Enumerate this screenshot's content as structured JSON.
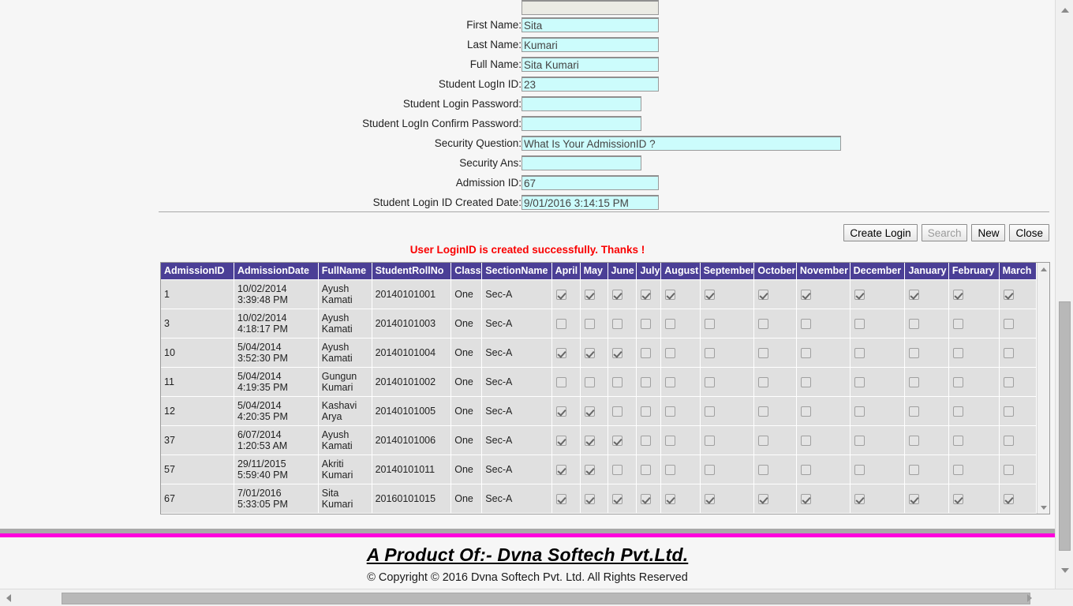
{
  "form": {
    "fields": [
      {
        "label": "First Name:",
        "value": "Sita",
        "placeholder": "",
        "width": "w-std",
        "type": "text"
      },
      {
        "label": "Last Name:",
        "value": "Kumari",
        "placeholder": "",
        "width": "w-std",
        "type": "text"
      },
      {
        "label": "Full Name:",
        "value": "Sita Kumari",
        "placeholder": "",
        "width": "w-std",
        "type": "text"
      },
      {
        "label": "Student LogIn ID:",
        "value": "23",
        "placeholder": "",
        "width": "w-std",
        "type": "text"
      },
      {
        "label": "Student Login Password:",
        "value": "",
        "placeholder": "",
        "width": "w-pw",
        "type": "password"
      },
      {
        "label": "Student LogIn Confirm Password:",
        "value": "",
        "placeholder": "",
        "width": "w-pw",
        "type": "password"
      },
      {
        "label": "Security Question:",
        "value": "What Is Your AdmissionID ?",
        "placeholder": "",
        "width": "w-long",
        "type": "text"
      },
      {
        "label": "Security Ans:",
        "value": "",
        "placeholder": "",
        "width": "w-pw",
        "type": "text"
      },
      {
        "label": "Admission ID:",
        "value": "67",
        "placeholder": "",
        "width": "w-std",
        "type": "text"
      },
      {
        "label": "Student Login ID Created Date:",
        "value": "9/01/2016 3:14:15 PM",
        "placeholder": "",
        "width": "w-std",
        "type": "text"
      }
    ]
  },
  "buttons": [
    {
      "label": "Create Login",
      "disabled": false
    },
    {
      "label": "Search",
      "disabled": true
    },
    {
      "label": "New",
      "disabled": false
    },
    {
      "label": "Close",
      "disabled": false
    }
  ],
  "status": {
    "message": "User LoginID is created successfully. Thanks !",
    "color": "#fa0000"
  },
  "grid": {
    "columns": [
      "AdmissionID",
      "AdmissionDate",
      "FullName",
      "StudentRollNo",
      "Class",
      "SectionName",
      "April",
      "May",
      "June",
      "July",
      "August",
      "September",
      "October",
      "November",
      "December",
      "January",
      "February",
      "March"
    ],
    "rows": [
      {
        "admission_id": "1",
        "date": "10/02/2014",
        "time": "3:39:48 PM",
        "first_name": "Ayush",
        "last_name": "Kamati",
        "roll_no": "20140101001",
        "class": "One",
        "section": "Sec-A",
        "months": [
          true,
          true,
          true,
          true,
          true,
          true,
          true,
          true,
          true,
          true,
          true,
          true
        ]
      },
      {
        "admission_id": "3",
        "date": "10/02/2014",
        "time": "4:18:17 PM",
        "first_name": "Ayush",
        "last_name": "Kamati",
        "roll_no": "20140101003",
        "class": "One",
        "section": "Sec-A",
        "months": [
          false,
          false,
          false,
          false,
          false,
          false,
          false,
          false,
          false,
          false,
          false,
          false
        ]
      },
      {
        "admission_id": "10",
        "date": "5/04/2014",
        "time": "3:52:30 PM",
        "first_name": "Ayush",
        "last_name": "Kamati",
        "roll_no": "20140101004",
        "class": "One",
        "section": "Sec-A",
        "months": [
          true,
          true,
          true,
          false,
          false,
          false,
          false,
          false,
          false,
          false,
          false,
          false
        ]
      },
      {
        "admission_id": "11",
        "date": "5/04/2014",
        "time": "4:19:35 PM",
        "first_name": "Gungun",
        "last_name": "Kumari",
        "roll_no": "20140101002",
        "class": "One",
        "section": "Sec-A",
        "months": [
          false,
          false,
          false,
          false,
          false,
          false,
          false,
          false,
          false,
          false,
          false,
          false
        ]
      },
      {
        "admission_id": "12",
        "date": "5/04/2014",
        "time": "4:20:35 PM",
        "first_name": "Kashavi",
        "last_name": "Arya",
        "roll_no": "20140101005",
        "class": "One",
        "section": "Sec-A",
        "months": [
          true,
          true,
          false,
          false,
          false,
          false,
          false,
          false,
          false,
          false,
          false,
          false
        ]
      },
      {
        "admission_id": "37",
        "date": "6/07/2014",
        "time": "1:20:53 AM",
        "first_name": "Ayush",
        "last_name": "Kamati",
        "roll_no": "20140101006",
        "class": "One",
        "section": "Sec-A",
        "months": [
          true,
          true,
          true,
          false,
          false,
          false,
          false,
          false,
          false,
          false,
          false,
          false
        ]
      },
      {
        "admission_id": "57",
        "date": "29/11/2015",
        "time": "5:59:40 PM",
        "first_name": "Akriti",
        "last_name": "Kumari",
        "roll_no": "20140101011",
        "class": "One",
        "section": "Sec-A",
        "months": [
          true,
          true,
          false,
          false,
          false,
          false,
          false,
          false,
          false,
          false,
          false,
          false
        ]
      },
      {
        "admission_id": "67",
        "date": "7/01/2016",
        "time": "5:33:05 PM",
        "first_name": "Sita",
        "last_name": "Kumari",
        "roll_no": "20160101015",
        "class": "One",
        "section": "Sec-A",
        "months": [
          true,
          true,
          true,
          true,
          true,
          true,
          true,
          true,
          true,
          true,
          true,
          true
        ]
      }
    ],
    "header_bg": "#4b3f96",
    "row_bg": "#e0e0e0"
  },
  "footer": {
    "title": "A Product Of:- Dvna Softech Pvt.Ltd.",
    "copyright": "© Copyright © 2016 Dvna Softech Pvt. Ltd. All Rights Reserved",
    "accent_color": "#ff00dc"
  }
}
